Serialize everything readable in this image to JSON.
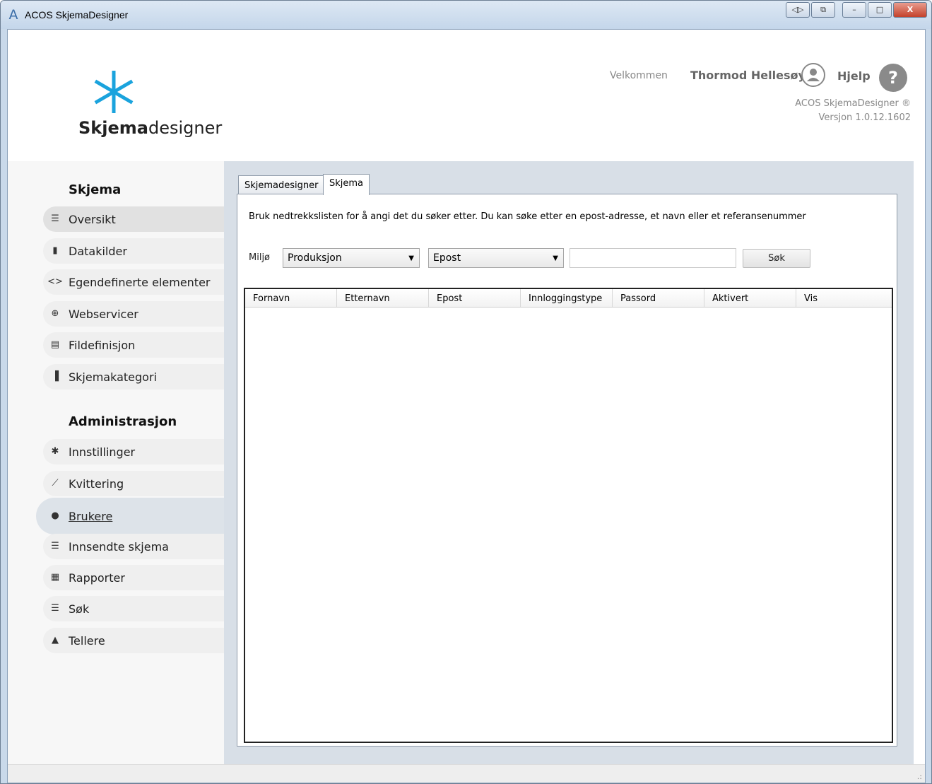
{
  "window": {
    "title": "ACOS SkjemaDesigner",
    "app_icon": "A",
    "buttons": [
      "◁▷",
      "⧉",
      "–",
      "□",
      "X"
    ]
  },
  "header": {
    "logo_bold": "Skjema",
    "logo_light": "designer",
    "welcome": "Velkommen",
    "username": "Thormod Hellesøy",
    "help": "Hjelp",
    "help_symbol": "?",
    "product": "ACOS SkjemaDesigner ®",
    "version": "Versjon 1.0.12.1602",
    "brand_color": "#1aa3dd"
  },
  "sidebar": {
    "section1": "Skjema",
    "section2": "Administrasjon",
    "items": [
      {
        "label": "Oversikt",
        "icon": "☰"
      },
      {
        "label": "Datakilder",
        "icon": "▮"
      },
      {
        "label": "Egendefinerte elementer",
        "icon": "<>"
      },
      {
        "label": "Webservicer",
        "icon": "⊕"
      },
      {
        "label": "Fildefinisjon",
        "icon": "▤"
      },
      {
        "label": "Skjemakategori",
        "icon": "▐"
      },
      {
        "label": "Innstillinger",
        "icon": "✱"
      },
      {
        "label": "Kvittering",
        "icon": "⟋"
      },
      {
        "label": "Brukere",
        "icon": "●"
      },
      {
        "label": "Innsendte skjema",
        "icon": "☰"
      },
      {
        "label": "Rapporter",
        "icon": "▦"
      },
      {
        "label": "Søk",
        "icon": "☰"
      },
      {
        "label": "Tellere",
        "icon": "▲"
      }
    ]
  },
  "tabs": [
    "Skjemadesigner",
    "Skjema"
  ],
  "panel": {
    "instructions": "Bruk nedtrekkslisten for å angi det du søker etter. Du kan søke etter en epost-adresse, et navn eller et referansenummer",
    "env_label": "Miljø",
    "env_value": "Produksjon",
    "field_value": "Epost",
    "search_value": "",
    "search_button": "Søk",
    "columns": [
      "Fornavn",
      "Etternavn",
      "Epost",
      "Innloggingstype",
      "Passord",
      "Aktivert",
      "Vis"
    ]
  }
}
